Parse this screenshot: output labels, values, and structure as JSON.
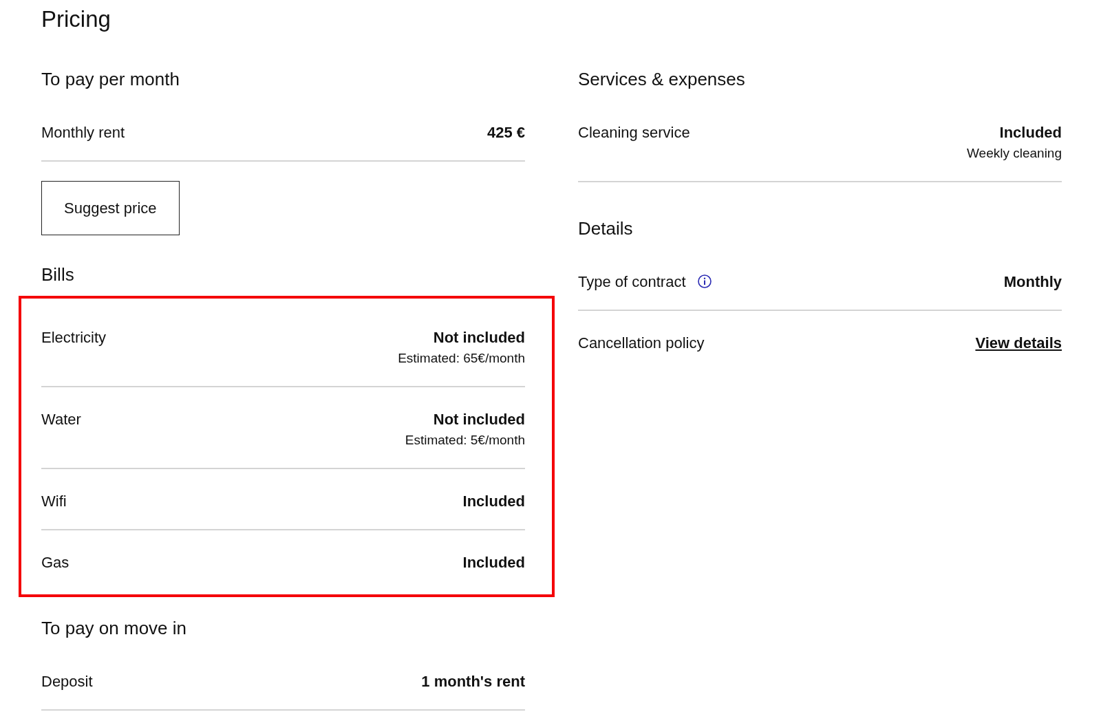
{
  "title": "Pricing",
  "monthly": {
    "heading": "To pay per month",
    "rows": [
      {
        "label": "Monthly rent",
        "value": "425 €"
      }
    ],
    "button": "Suggest price"
  },
  "bills": {
    "heading": "Bills",
    "highlighted": true,
    "rows": [
      {
        "label": "Electricity",
        "value": "Not included",
        "note": "Estimated: 65€/month"
      },
      {
        "label": "Water",
        "value": "Not included",
        "note": "Estimated: 5€/month"
      },
      {
        "label": "Wifi",
        "value": "Included"
      },
      {
        "label": "Gas",
        "value": "Included"
      }
    ]
  },
  "move_in": {
    "heading": "To pay on move in",
    "rows": [
      {
        "label": "Deposit",
        "value": "1 month's rent"
      }
    ]
  },
  "services": {
    "heading": "Services & expenses",
    "rows": [
      {
        "label": "Cleaning service",
        "value": "Included",
        "note": "Weekly cleaning"
      }
    ]
  },
  "details": {
    "heading": "Details",
    "rows": [
      {
        "kind": "text",
        "label": "Type of contract",
        "info": true,
        "value": "Monthly"
      },
      {
        "kind": "link",
        "label": "Cancellation policy",
        "value": "View details"
      }
    ]
  }
}
